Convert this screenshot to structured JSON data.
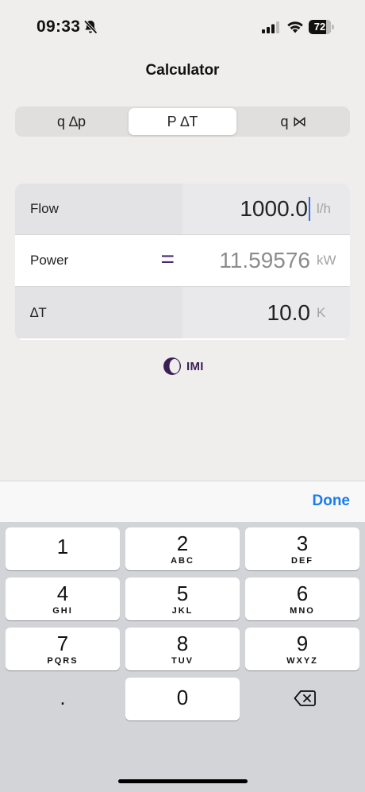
{
  "status": {
    "time": "09:33",
    "battery": "72"
  },
  "nav": {
    "title": "Calculator"
  },
  "segments": [
    {
      "label": "q ∆p"
    },
    {
      "label": "P ∆T"
    },
    {
      "label": "q ⋈"
    }
  ],
  "rows": {
    "flow": {
      "label": "Flow",
      "value": "1000.0",
      "unit": "l/h"
    },
    "power": {
      "label": "Power",
      "equals": "=",
      "value": "11.59576",
      "unit": "kW"
    },
    "delta_t": {
      "label": "∆T",
      "value": "10.0",
      "unit": "K"
    }
  },
  "brand": {
    "text": "IMI",
    "color": "#3a1f55"
  },
  "keyboard": {
    "done": "Done",
    "keys": [
      {
        "digit": "1",
        "letters": ""
      },
      {
        "digit": "2",
        "letters": "ABC"
      },
      {
        "digit": "3",
        "letters": "DEF"
      },
      {
        "digit": "4",
        "letters": "GHI"
      },
      {
        "digit": "5",
        "letters": "JKL"
      },
      {
        "digit": "6",
        "letters": "MNO"
      },
      {
        "digit": "7",
        "letters": "PQRS"
      },
      {
        "digit": "8",
        "letters": "TUV"
      },
      {
        "digit": "9",
        "letters": "WXYZ"
      },
      {
        "digit": ".",
        "letters": ""
      },
      {
        "digit": "0",
        "letters": ""
      }
    ]
  },
  "colors": {
    "accent": "#1a7cf0",
    "caret": "#2f6df6",
    "equals": "#4a2a6e"
  },
  "icons": [
    "bell-slash-icon",
    "cellular-signal-icon",
    "wifi-icon",
    "battery-icon",
    "imi-logo-icon",
    "backspace-icon"
  ]
}
